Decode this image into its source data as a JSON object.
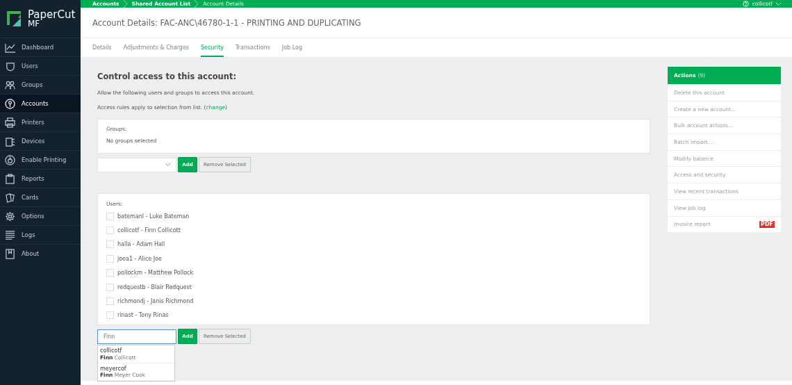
{
  "logo": {
    "name": "PaperCut",
    "edition": "MF"
  },
  "sidebar": {
    "items": [
      {
        "label": "Dashboard",
        "selected": false
      },
      {
        "label": "Users",
        "selected": false
      },
      {
        "label": "Groups",
        "selected": false
      },
      {
        "label": "Accounts",
        "selected": true
      },
      {
        "label": "Printers",
        "selected": false
      },
      {
        "label": "Devices",
        "selected": false
      },
      {
        "label": "Enable Printing",
        "selected": false
      },
      {
        "label": "Reports",
        "selected": false
      },
      {
        "label": "Cards",
        "selected": false
      },
      {
        "label": "Options",
        "selected": false
      },
      {
        "label": "Logs",
        "selected": false
      },
      {
        "label": "About",
        "selected": false
      }
    ]
  },
  "breadcrumbs": [
    "Accounts",
    "Shared Account List",
    "Account Details"
  ],
  "user_menu": {
    "name": "collicotf"
  },
  "page_title": "Account Details: FAC-ANC\\46780-1-1 - PRINTING AND DUPLICATING",
  "tabs": [
    {
      "label": "Details",
      "selected": false
    },
    {
      "label": "Adjustments & Charges",
      "selected": false
    },
    {
      "label": "Security",
      "selected": true
    },
    {
      "label": "Transactions",
      "selected": false
    },
    {
      "label": "Job Log",
      "selected": false
    }
  ],
  "section_title": "Control access to this account:",
  "intro": "Allow the following users and groups to access this account.",
  "rules_note": {
    "text": "Access rules apply to selection from list. (",
    "link": "change",
    "after": ")"
  },
  "groups": {
    "heading": "Groups:",
    "empty_text": "No groups selected",
    "add": "Add",
    "remove": "Remove Selected"
  },
  "users": {
    "heading": "Users:",
    "items": [
      {
        "label": "batemanl - Luke Bateman",
        "checked": false
      },
      {
        "label": "collicotf - Finn Collicott",
        "checked": false
      },
      {
        "label": "halla - Adam Hall",
        "checked": false
      },
      {
        "label": "joea1 - Alice Joe",
        "checked": false
      },
      {
        "label": "pollockm - Matthew Pollock",
        "checked": false
      },
      {
        "label": "redquestb - Blair Redquest",
        "checked": false
      },
      {
        "label": "richmondj - Janis Richmond",
        "checked": false
      },
      {
        "label": "rinast - Tony Rinas",
        "checked": false
      }
    ],
    "search_value": "Finn",
    "add": "Add",
    "remove": "Remove Selected",
    "suggestions": [
      {
        "username": "collicotf",
        "full_name": "**Finn** Collicott"
      },
      {
        "username": "meyercof",
        "full_name": "**Finn** Meyer Cook"
      }
    ]
  },
  "actions": {
    "title": "Actions",
    "count": "(9)",
    "items": [
      {
        "label": "Delete this account"
      },
      {
        "label": "Create a new account..."
      },
      {
        "label": "Bulk account actions..."
      },
      {
        "label": "Batch import..."
      },
      {
        "label": "Modify balance"
      },
      {
        "label": "Access and security"
      },
      {
        "label": "View recent transactions"
      },
      {
        "label": "View job log"
      },
      {
        "label": "Invoice report",
        "badge": "PDF"
      }
    ]
  }
}
